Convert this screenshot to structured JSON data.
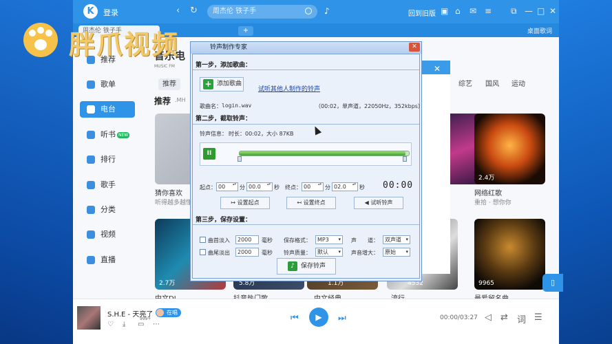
{
  "watermark": {
    "text": "胖爪视频"
  },
  "topbar": {
    "login": "登录",
    "search_placeholder": "周杰伦 铁子手",
    "old_version": "回到旧版",
    "desk_lyric": "桌面歌词"
  },
  "sidebar": {
    "items": [
      {
        "label": "推荐"
      },
      {
        "label": "歌单"
      },
      {
        "label": "电台"
      },
      {
        "label": "听书",
        "badge": "NEW"
      },
      {
        "label": "排行"
      },
      {
        "label": "歌手"
      },
      {
        "label": "分类"
      },
      {
        "label": "视频"
      },
      {
        "label": "直播"
      }
    ]
  },
  "content": {
    "fm_title": "音乐电",
    "fm_sub": "MUSIC FM",
    "categories": [
      "推荐",
      "综艺",
      "国风",
      "运动"
    ],
    "rec_title": "推荐",
    "rec_sub": ".MH",
    "cards_row1": [
      {
        "title": "猜你喜欢",
        "sub": "听得越多越懂你"
      },
      {
        "title": "网络红歌",
        "sub": "重拾 · 想你你",
        "count": "2.4万"
      }
    ],
    "cards_row2": [
      {
        "count": "2.7万",
        "title": "中文DJ"
      },
      {
        "count": "5.8万",
        "title": "抖音热门歌"
      },
      {
        "count": "1.1万",
        "title": "中文经典"
      },
      {
        "count": "4532",
        "title": "流行"
      },
      {
        "count": "9965",
        "title": "最爱留名曲"
      }
    ],
    "partial_text": "乐"
  },
  "dialog": {
    "title": "铃声制作专家",
    "step1": "第一步，添加歌曲：",
    "add_song": "添加歌曲",
    "listen_link": "试听其他人制作的铃声",
    "song_name_label": "歌曲名：",
    "song_name": "login.wav",
    "song_info": "（00:02，单声道，22050Hz，352kbps）",
    "step2": "第二步，截取铃声：",
    "ring_info_label": "铃声信息：",
    "ring_info": "时长：00:02，大小 87KB",
    "play_icon": "pause",
    "start_label": "起点：",
    "end_label": "终点：",
    "unit_min": "分",
    "unit_sec": "秒",
    "start_min": "00",
    "start_sec": "00.0",
    "end_min": "00",
    "end_sec": "02.0",
    "timer": "00:00",
    "progress_fraction": 0.98,
    "set_start": "设置起点",
    "set_end": "设置终点",
    "preview": "试听铃声",
    "step3": "第三步，保存设置：",
    "fade_in": "曲首淡入",
    "fade_out": "曲尾淡出",
    "fade_in_ms": "2000",
    "fade_out_ms": "2000",
    "ms_unit": "毫秒",
    "format_label": "保存格式：",
    "format": "MP3",
    "quality_label": "铃声质量：",
    "quality": "默认",
    "channel_label": "声　　道：",
    "channel": "双声道",
    "gain_label": "声音增大：",
    "gain": "原始",
    "save_btn": "保存铃声"
  },
  "player": {
    "song": "S.H.E - 天亮了",
    "live": "在唱",
    "badge": "999+",
    "time": "00:00/03:27"
  },
  "colors": {
    "accent": "#2f93e8",
    "dialog_bg": "#e5eefa",
    "progress": "#3da22d"
  }
}
